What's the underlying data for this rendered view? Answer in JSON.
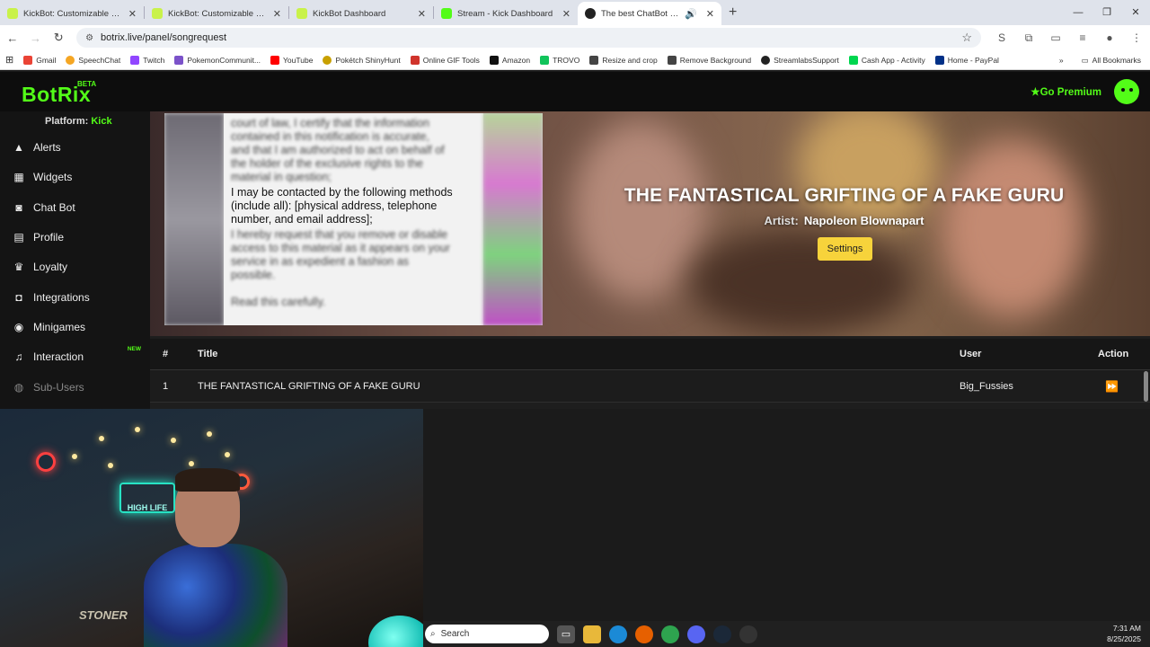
{
  "browser": {
    "tabs": [
      {
        "title": "KickBot: Customizable Chat Bo",
        "color": "#c9f24a"
      },
      {
        "title": "KickBot: Customizable Chat Bo",
        "color": "#c9f24a"
      },
      {
        "title": "KickBot Dashboard",
        "color": "#c9f24a"
      },
      {
        "title": "Stream - Kick Dashboard",
        "color": "#53fc18"
      },
      {
        "title": "The best ChatBot and Widg",
        "color": "#222222"
      }
    ],
    "url": "botrix.live/panel/songrequest",
    "bookmarks": [
      "Gmail",
      "SpeechChat",
      "Twitch",
      "PokemonCommunit...",
      "YouTube",
      "Pokétch ShinyHunt",
      "Online GIF Tools",
      "Amazon",
      "TROVO",
      "Resize and crop",
      "Remove Background",
      "StreamlabsSupport",
      "Cash App - Activity",
      "Home - PayPal"
    ],
    "bookmark_colors": [
      "#ea4335",
      "#f5a623",
      "#9146ff",
      "#7b52c9",
      "#ff0000",
      "#c8a000",
      "#d0342c",
      "#111111",
      "#11c45b",
      "#444444",
      "#444444",
      "#222222",
      "#00d64f",
      "#003087"
    ],
    "all_bookmarks": "All Bookmarks"
  },
  "app": {
    "logo": "BotRix",
    "beta": "BETA",
    "go_premium": "Go Premium"
  },
  "sidebar": {
    "platform_label": "Platform:",
    "platform_value": "Kick",
    "items": [
      {
        "label": "Alerts",
        "icon": "warning-icon"
      },
      {
        "label": "Widgets",
        "icon": "widgets-icon"
      },
      {
        "label": "Chat Bot",
        "icon": "robot-icon"
      },
      {
        "label": "Profile",
        "icon": "profile-icon"
      },
      {
        "label": "Loyalty",
        "icon": "trophy-icon"
      },
      {
        "label": "Integrations",
        "icon": "integrations-icon"
      },
      {
        "label": "Minigames",
        "icon": "gamepad-icon"
      },
      {
        "label": "Interaction",
        "icon": "music-icon"
      },
      {
        "label": "Sub-Users",
        "icon": "users-icon"
      }
    ],
    "new_badge": "NEW"
  },
  "now_playing": {
    "doc_lines_blur_top": [
      "court of law, I certify that the information",
      "contained in this notification is accurate,",
      "and that I am authorized to act on behalf of",
      "the holder of the exclusive rights to the",
      "material in question;"
    ],
    "doc_lines_sharp": [
      "I may be contacted by the following methods",
      "(include all): [physical address, telephone",
      "number, and email address];"
    ],
    "doc_lines_blur_bottom": [
      "I hereby request that you remove or disable",
      "access to this material as it appears on your",
      "service in as expedient a fashion as",
      "possible."
    ],
    "doc_footer": "Read this carefully.",
    "title": "THE FANTASTICAL GRIFTING OF A FAKE GURU",
    "artist_label": "Artist:",
    "artist": "Napoleon Blownapart",
    "settings_label": "Settings"
  },
  "queue": {
    "headers": {
      "num": "#",
      "title": "Title",
      "user": "User",
      "action": "Action"
    },
    "rows": [
      {
        "num": "1",
        "title": "THE FANTASTICAL GRIFTING OF A FAKE GURU",
        "user": "Big_Fussies"
      }
    ]
  },
  "webcam": {
    "sign_text": "HIGH LIFE",
    "shelf_text": "STONER"
  },
  "taskbar": {
    "search_placeholder": "Search",
    "time": "7:31 AM",
    "date": "8/25/2025"
  }
}
